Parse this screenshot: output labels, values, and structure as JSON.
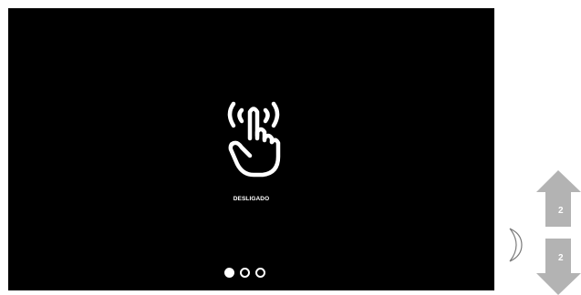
{
  "screen": {
    "status_label": "DESLIGADO",
    "icon": "touch-hand-icon",
    "pagination": {
      "total": 3,
      "active_index": 0
    }
  },
  "side_controls": {
    "back_icon": "chevron-left-icon",
    "up_arrow": {
      "icon": "arrow-up-icon",
      "label": "2"
    },
    "down_arrow": {
      "icon": "arrow-down-icon",
      "label": "2"
    }
  },
  "colors": {
    "screen_bg": "#000000",
    "foreground": "#ffffff",
    "arrow_gray": "#b3b3b3",
    "background": "#ffffff"
  }
}
